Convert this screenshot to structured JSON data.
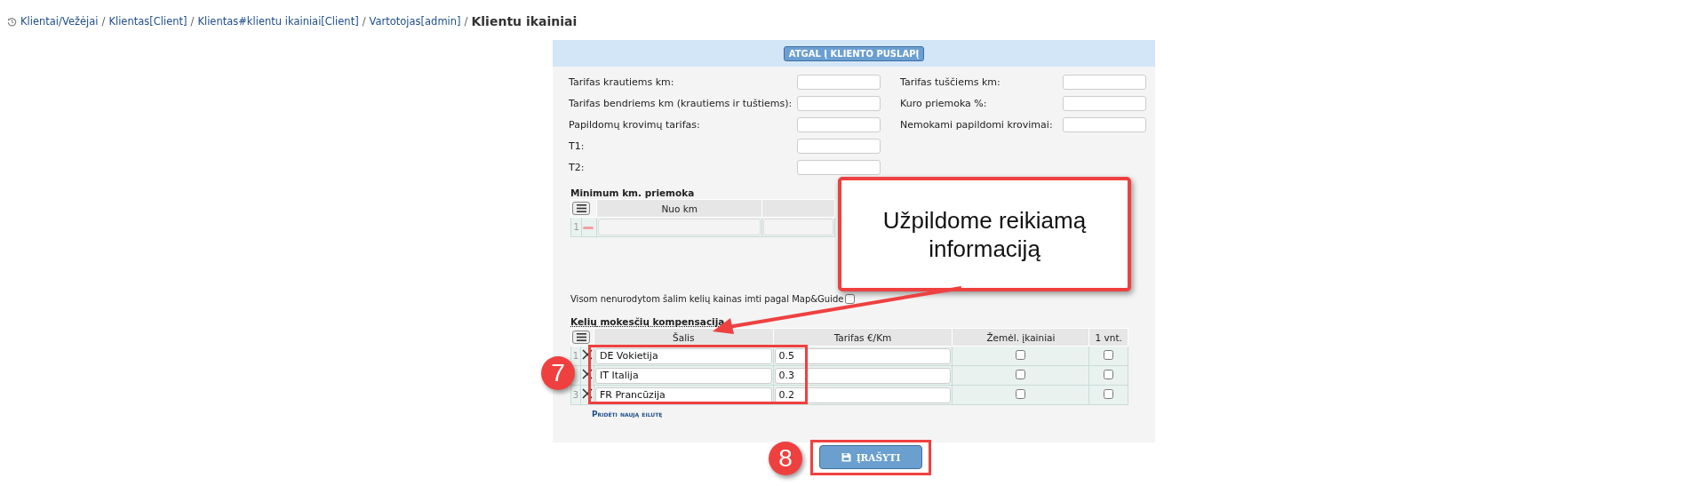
{
  "breadcrumb": {
    "links": [
      {
        "label": "Klientai/Vežėjai",
        "separator": "/"
      },
      {
        "label": "Klientas[Client]",
        "separator": "/"
      },
      {
        "label": "Klientas#klientu ikainiai[Client]",
        "separator": "/"
      },
      {
        "label": "Vartotojas[admin]",
        "separator": "/"
      }
    ],
    "current": "Klientu ikainiai"
  },
  "back_button": "ATGAL Į KLIENTO PUSLAPĮ",
  "form_fields": {
    "left": [
      {
        "label": "Tarifas krautiems km:"
      },
      {
        "label": "Tarifas bendriems km (krautiems ir tuštiems):"
      },
      {
        "label": "Papildomų krovimų tarifas:"
      },
      {
        "label": "T1:"
      },
      {
        "label": "T2:"
      }
    ],
    "right": [
      {
        "label": "Tarifas tuščiems km:"
      },
      {
        "label": "Kuro priemoka %:"
      },
      {
        "label": "Nemokami papildomi krovimai:"
      }
    ]
  },
  "min_km": {
    "title": "Minimum km. priemoka",
    "columns": [
      "Nuo km"
    ],
    "rows": [
      {
        "index": "1"
      }
    ]
  },
  "map_guide_option": {
    "label": "Visom nenurodytom šalim kelių kainas imti pagal Map&Guide",
    "checked": false
  },
  "road_tax": {
    "title": "Kelių mokesčių kompensacija",
    "columns": [
      "Šalis",
      "Tarifas €/Km",
      "Žemėl. įkainiai",
      "1 vnt."
    ],
    "rows": [
      {
        "index": "1",
        "country": "DE Vokietija",
        "rate": "0.5",
        "map_prices": false,
        "per_unit": false
      },
      {
        "country": "IT Italija",
        "rate": "0.3",
        "map_prices": false,
        "per_unit": false
      },
      {
        "index": "3",
        "country": "FR Prancūzija",
        "rate": "0.2",
        "map_prices": false,
        "per_unit": false
      }
    ],
    "add_row": "Pridėti naują eilutę"
  },
  "save_button": "ĮRAŠYTI",
  "annotations": {
    "callout": [
      "Užpildome reikiamą",
      "informaciją"
    ],
    "badges": [
      "7",
      "8"
    ]
  }
}
